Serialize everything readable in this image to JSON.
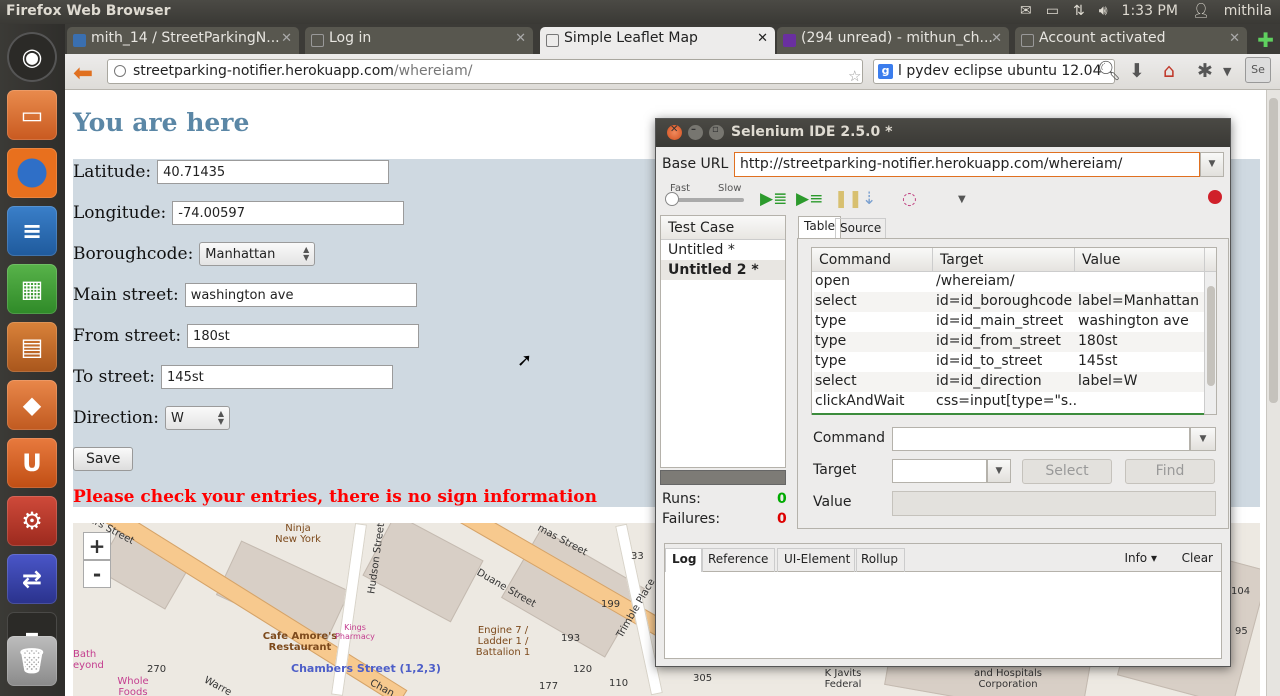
{
  "panel": {
    "title": "Firefox Web Browser",
    "time": "1:33 PM",
    "user": "mithila",
    "mail_icon": "mail-icon",
    "battery_icon": "battery-icon",
    "network_icon": "network-icon",
    "volume_icon": "volume-icon"
  },
  "launcher": {
    "items": [
      "ubuntu-dash-icon",
      "files-icon",
      "firefox-icon",
      "writer-icon",
      "calc-icon",
      "impress-icon",
      "software-center-icon",
      "ubuntu-one-icon",
      "system-settings-icon",
      "network-tool-icon",
      "workspace-icon",
      "trash-icon"
    ]
  },
  "tabs": [
    {
      "label": "mith_14 / StreetParkingN...",
      "active": false
    },
    {
      "label": "Log in",
      "active": false
    },
    {
      "label": "Simple Leaflet Map",
      "active": true
    },
    {
      "label": "(294 unread) - mithun_ch...",
      "active": false
    },
    {
      "label": "Account activated",
      "active": false
    }
  ],
  "navbar": {
    "url_host": "streetparking-notifier.herokuapp.com",
    "url_path": "/whereiam/",
    "search_value": "l pydev eclipse ubuntu 12.04"
  },
  "page": {
    "title": "You are here",
    "latitude_label": "Latitude:",
    "latitude_value": "40.71435",
    "longitude_label": "Longitude:",
    "longitude_value": "-74.00597",
    "borough_label": "Boroughcode:",
    "borough_value": "Manhattan",
    "main_label": "Main street:",
    "main_value": "washington ave",
    "from_label": "From street:",
    "from_value": "180st",
    "to_label": "To street:",
    "to_value": "145st",
    "direction_label": "Direction:",
    "direction_value": "W",
    "save_label": "Save",
    "error": "Please check your entries, there is no sign information"
  },
  "map": {
    "zoom_in": "+",
    "zoom_out": "-",
    "labels": {
      "street1": "ers Street",
      "ninja": "Ninja New York",
      "hudson": "Hudson Street",
      "thomas": "mas Street",
      "duane": "Duane Street",
      "trimble": "Trimble Place",
      "cafe": "Cafe Amore's Restaurant",
      "kings": "Kings Pharmacy",
      "engine": "Engine 7 / Ladder 1 / Battalion 1",
      "chambers": "Chambers Street (1,2,3)",
      "bath": "Bath eyond",
      "whole": "Whole Foods",
      "warren": "Warre",
      "chan": "Chan",
      "javits": "K Javits Federal",
      "hospitals": "and Hospitals Corporation",
      "n33": "33",
      "n199": "199",
      "n193": "193",
      "n120": "120",
      "n270": "270",
      "n177": "177",
      "n110": "110",
      "n305": "305",
      "n104": "104",
      "n95": "95"
    }
  },
  "selenium": {
    "title": "Selenium IDE 2.5.0 *",
    "base_url_label": "Base URL",
    "base_url": "http://streetparking-notifier.herokuapp.com/whereiam/",
    "speed_fast": "Fast",
    "speed_slow": "Slow",
    "testcase_header": "Test Case",
    "testcases": [
      "Untitled *",
      "Untitled 2 *"
    ],
    "runs_label": "Runs:",
    "runs_value": "0",
    "failures_label": "Failures:",
    "failures_value": "0",
    "tab_table": "Table",
    "tab_source": "Source",
    "columns": [
      "Command",
      "Target",
      "Value"
    ],
    "rows": [
      [
        "open",
        "/whereiam/",
        ""
      ],
      [
        "select",
        "id=id_boroughcode",
        "label=Manhattan"
      ],
      [
        "type",
        "id=id_main_street",
        "washington ave"
      ],
      [
        "type",
        "id=id_from_street",
        "180st"
      ],
      [
        "type",
        "id=id_to_street",
        "145st"
      ],
      [
        "select",
        "id=id_direction",
        "label=W"
      ],
      [
        "clickAndWait",
        "css=input[type=\"s...",
        ""
      ]
    ],
    "command_label": "Command",
    "target_label": "Target",
    "value_label": "Value",
    "select_button": "Select",
    "find_button": "Find",
    "log_tabs": [
      "Log",
      "Reference",
      "UI-Element",
      "Rollup"
    ],
    "info_menu": "Info ▾",
    "clear_button": "Clear"
  }
}
